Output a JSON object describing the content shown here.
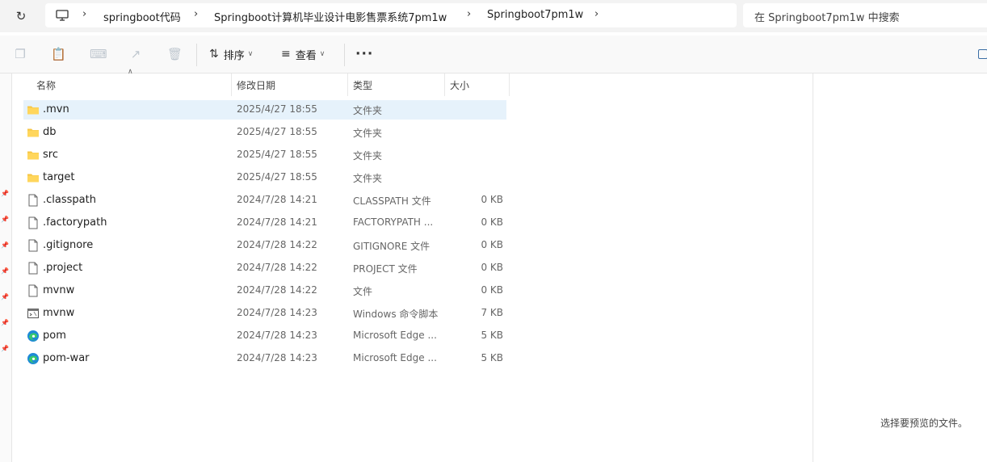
{
  "breadcrumb": {
    "items": [
      "springboot代码",
      "Springboot计算机毕业设计电影售票系统7pm1w",
      "Springboot7pm1w"
    ]
  },
  "search": {
    "placeholder": "在 Springboot7pm1w 中搜索"
  },
  "toolbar": {
    "sort_label": "排序",
    "view_label": "查看"
  },
  "columns": {
    "name": "名称",
    "modified": "修改日期",
    "type": "类型",
    "size": "大小"
  },
  "files": [
    {
      "name": ".mvn",
      "date": "2025/4/27 18:55",
      "type": "文件夹",
      "size": "",
      "icon": "folder-icon"
    },
    {
      "name": "db",
      "date": "2025/4/27 18:55",
      "type": "文件夹",
      "size": "",
      "icon": "folder-icon"
    },
    {
      "name": "src",
      "date": "2025/4/27 18:55",
      "type": "文件夹",
      "size": "",
      "icon": "folder-icon"
    },
    {
      "name": "target",
      "date": "2025/4/27 18:55",
      "type": "文件夹",
      "size": "",
      "icon": "folder-icon"
    },
    {
      "name": ".classpath",
      "date": "2024/7/28 14:21",
      "type": "CLASSPATH 文件",
      "size": "0 KB",
      "icon": "file-icon"
    },
    {
      "name": ".factorypath",
      "date": "2024/7/28 14:21",
      "type": "FACTORYPATH ...",
      "size": "0 KB",
      "icon": "file-icon"
    },
    {
      "name": ".gitignore",
      "date": "2024/7/28 14:22",
      "type": "GITIGNORE 文件",
      "size": "0 KB",
      "icon": "file-icon"
    },
    {
      "name": ".project",
      "date": "2024/7/28 14:22",
      "type": "PROJECT 文件",
      "size": "0 KB",
      "icon": "file-icon"
    },
    {
      "name": "mvnw",
      "date": "2024/7/28 14:22",
      "type": "文件",
      "size": "0 KB",
      "icon": "file-icon"
    },
    {
      "name": "mvnw",
      "date": "2024/7/28 14:23",
      "type": "Windows 命令脚本",
      "size": "7 KB",
      "icon": "script-icon"
    },
    {
      "name": "pom",
      "date": "2024/7/28 14:23",
      "type": "Microsoft Edge ...",
      "size": "5 KB",
      "icon": "edge-icon"
    },
    {
      "name": "pom-war",
      "date": "2024/7/28 14:23",
      "type": "Microsoft Edge ...",
      "size": "5 KB",
      "icon": "edge-icon"
    }
  ],
  "preview": {
    "message": "选择要预览的文件。"
  },
  "colors": {
    "selection": "#e6f2fb",
    "folder": "#f6c544",
    "accent": "#0067c0"
  }
}
